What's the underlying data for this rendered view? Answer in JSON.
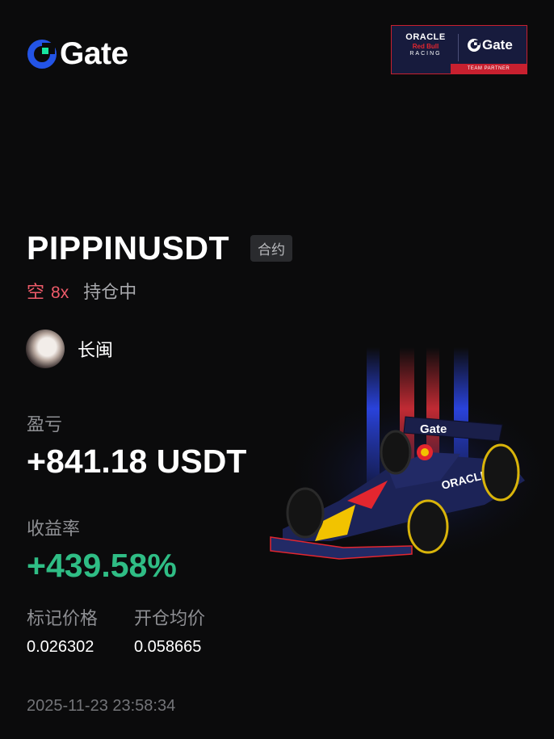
{
  "brand": {
    "name": "Gate",
    "accent_color": "#17e6a1",
    "logo_blue": "#2354e6"
  },
  "partner_badge": {
    "team_line1": "ORACLE",
    "team_line2": "Red Bull",
    "team_line3": "RACING",
    "partner_brand": "Gate",
    "caption": "TEAM PARTNER"
  },
  "position": {
    "symbol": "PIPPINUSDT",
    "type_tag": "合约",
    "side": "空",
    "leverage": "8x",
    "status": "持仓中",
    "side_color": "#ef5b6a"
  },
  "user": {
    "name": "长闽",
    "avatar_icon": "avatar"
  },
  "pnl": {
    "label": "盈亏",
    "value": "+841.18 USDT"
  },
  "return_rate": {
    "label": "收益率",
    "value": "+439.58%",
    "color": "#2fbd85"
  },
  "prices": {
    "mark_label": "标记价格",
    "mark_value": "0.026302",
    "entry_label": "开仓均价",
    "entry_value": "0.058665"
  },
  "timestamp": "2025-11-23 23:58:34",
  "illustration": {
    "icon": "f1-race-car-image",
    "car_text": "Gate",
    "sidepod_text": "ORACLE"
  }
}
